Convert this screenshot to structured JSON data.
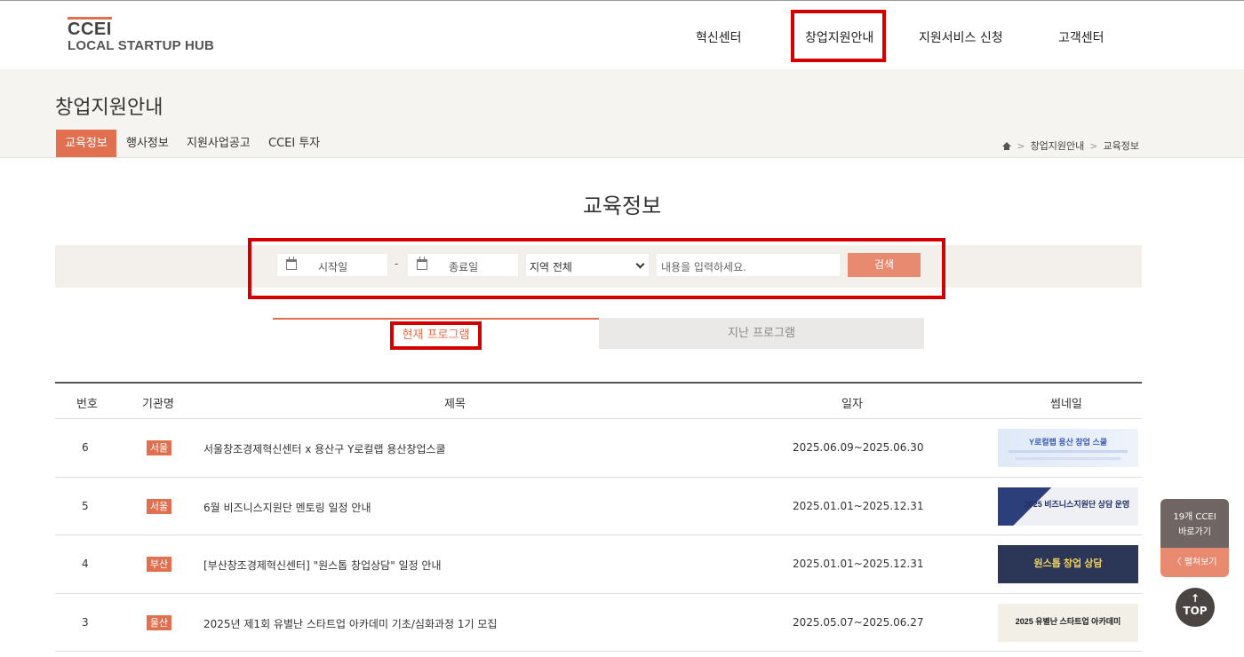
{
  "logo": {
    "line1": "CCEI",
    "line2": "LOCAL STARTUP HUB"
  },
  "gnb": [
    "혁신센터",
    "창업지원안내",
    "지원서비스 신청",
    "고객센터"
  ],
  "sub": {
    "title": "창업지원안내",
    "tabs": [
      "교육정보",
      "행사정보",
      "지원사업공고",
      "CCEI 투자"
    ],
    "breadcrumb": [
      "창업지원안내",
      "교육정보"
    ]
  },
  "heading": "교육정보",
  "search": {
    "start_label": "시작일",
    "end_label": "종료일",
    "dash": "-",
    "region": "지역 전체",
    "keyword_placeholder": "내용을 입력하세요.",
    "button": "검색"
  },
  "program_tabs": {
    "current": "현재 프로그램",
    "past": "지난 프로그램"
  },
  "table": {
    "headers": [
      "번호",
      "기관명",
      "제목",
      "일자",
      "썸네일"
    ],
    "rows": [
      {
        "no": "6",
        "org": "서울",
        "title": "서울창조경제혁신센터 x 용산구 Y로컬랩 용산창업스쿨",
        "date": "2025.06.09~2025.06.30",
        "thumb": "Y로컬랩 용산 창업 스쿨"
      },
      {
        "no": "5",
        "org": "서울",
        "title": "6월 비즈니스지원단 멘토링 일정 안내",
        "date": "2025.01.01~2025.12.31",
        "thumb": "2025 비즈니스지원단 상담 운영"
      },
      {
        "no": "4",
        "org": "부산",
        "title": "[부산창조경제혁신센터] \"원스톱 창업상담\" 일정 안내",
        "date": "2025.01.01~2025.12.31",
        "thumb": "원스톱 창업 상담"
      },
      {
        "no": "3",
        "org": "울산",
        "title": "2025년 제1회 유별난 스타트업 아카데미 기초/심화과정 1기 모집",
        "date": "2025.05.07~2025.06.27",
        "thumb": "2025 유별난 스타트업 아카데미"
      }
    ]
  },
  "floating": {
    "line1": "19개 CCEI",
    "line2": "바로가기",
    "expand": "펼쳐보기",
    "top": "TOP"
  }
}
